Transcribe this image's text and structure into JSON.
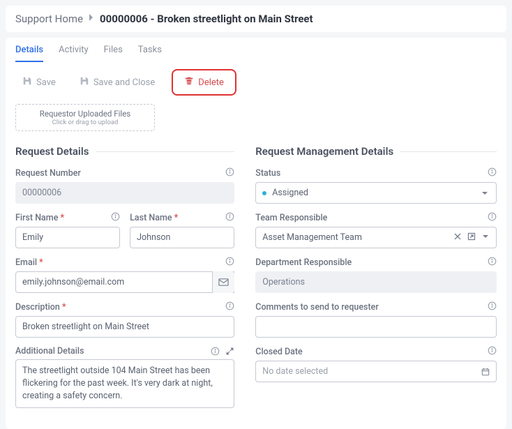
{
  "breadcrumb": {
    "home": "Support Home",
    "title": "00000006 - Broken streetlight on Main Street"
  },
  "tabs": {
    "details": "Details",
    "activity": "Activity",
    "files": "Files",
    "tasks": "Tasks"
  },
  "toolbar": {
    "save": "Save",
    "saveClose": "Save and Close",
    "delete": "Delete"
  },
  "upload": {
    "title": "Requestor Uploaded Files",
    "sub": "Click or drag to upload"
  },
  "sections": {
    "left": "Request Details",
    "right": "Request Management Details"
  },
  "left": {
    "requestNumber": {
      "label": "Request Number",
      "value": "00000006"
    },
    "firstName": {
      "label": "First Name",
      "value": "Emily"
    },
    "lastName": {
      "label": "Last Name",
      "value": "Johnson"
    },
    "email": {
      "label": "Email",
      "value": "emily.johnson@email.com"
    },
    "description": {
      "label": "Description",
      "value": "Broken streetlight on Main Street"
    },
    "additional": {
      "label": "Additional Details",
      "value": "The streetlight outside 104 Main Street has been flickering for the past week. It's very dark at night, creating a safety concern."
    }
  },
  "right": {
    "status": {
      "label": "Status",
      "value": "Assigned",
      "color": "#2cb0d6"
    },
    "team": {
      "label": "Team Responsible",
      "value": "Asset Management Team"
    },
    "dept": {
      "label": "Department Responsible",
      "value": "Operations"
    },
    "comments": {
      "label": "Comments to send to requester",
      "value": ""
    },
    "closed": {
      "label": "Closed Date",
      "value": "No date selected"
    }
  }
}
